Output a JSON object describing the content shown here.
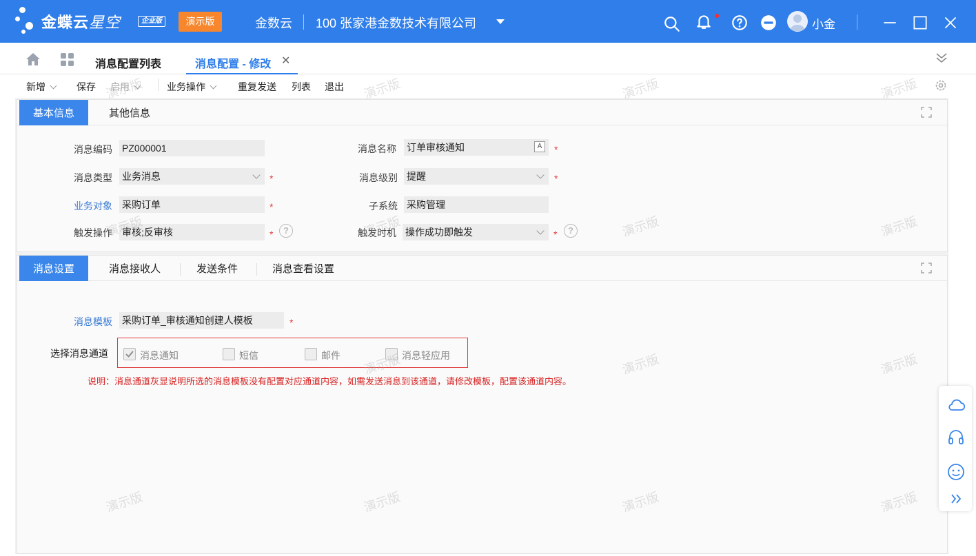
{
  "header": {
    "brand": "金蝶云",
    "brand_sub": "星空",
    "edition": "企业版",
    "demo_badge": "演示版",
    "org": "金数云",
    "company": "100  张家港金数技术有限公司",
    "user_name": "小金"
  },
  "tabs": {
    "list_tab": "消息配置列表",
    "active_tab": "消息配置 - 修改",
    "close_glyph": "✕"
  },
  "toolbar": {
    "new_label": "新增",
    "save_label": "保存",
    "enable_label": "启用",
    "business_ops_label": "业务操作",
    "resend_label": "重复发送",
    "list_label": "列表",
    "exit_label": "退出"
  },
  "basic_panel": {
    "tab_basic": "基本信息",
    "tab_other": "其他信息",
    "fields": {
      "code_label": "消息编码",
      "code_value": "PZ000001",
      "name_label": "消息名称",
      "name_value": "订单审核通知",
      "type_label": "消息类型",
      "type_value": "业务消息",
      "level_label": "消息级别",
      "level_value": "提醒",
      "object_label": "业务对象",
      "object_value": "采购订单",
      "subsystem_label": "子系统",
      "subsystem_value": "采购管理",
      "trigger_op_label": "触发操作",
      "trigger_op_value": "审核;反审核",
      "trigger_time_label": "触发时机",
      "trigger_time_value": "操作成功即触发"
    },
    "required_mark": "*",
    "help_glyph": "?"
  },
  "settings_panel": {
    "tab_settings": "消息设置",
    "tab_recipients": "消息接收人",
    "tab_conditions": "发送条件",
    "tab_view_settings": "消息查看设置",
    "template_label": "消息模板",
    "template_value": "采购订单_审核通知创建人模板",
    "channel_label": "选择消息通道",
    "channels": [
      {
        "label": "消息通知",
        "checked": true
      },
      {
        "label": "短信",
        "checked": false
      },
      {
        "label": "邮件",
        "checked": false
      },
      {
        "label": "消息轻应用",
        "checked": false
      }
    ],
    "note": "说明：消息通道灰显说明所选的消息模板没有配置对应通道内容，如需发送消息到该通道，请修改模板，配置该通道内容。"
  },
  "watermark_text": "演示版",
  "colors": {
    "header_bg": "#2f7ee9",
    "accent": "#3a86ea",
    "demo_badge": "#f7862c",
    "required": "#e23b3b",
    "note_red": "#d61f1f"
  }
}
